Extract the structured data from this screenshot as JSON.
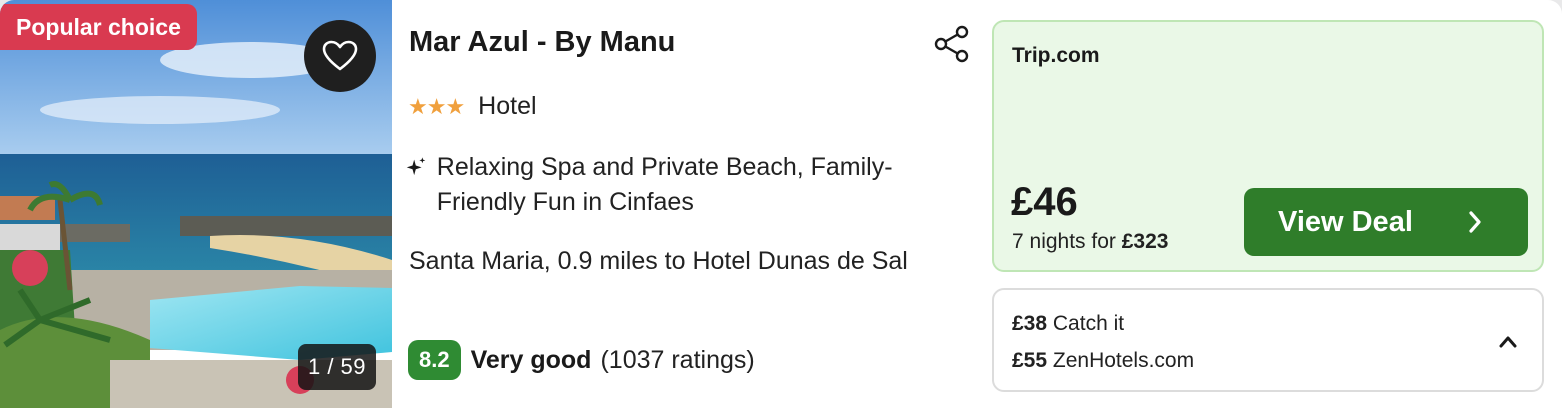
{
  "badge": {
    "label": "Popular choice"
  },
  "gallery": {
    "counter": "1 / 59"
  },
  "hotel": {
    "name": "Mar Azul - By Manu",
    "stars_glyph": "★★★",
    "star_count": 3,
    "type": "Hotel",
    "tagline": "Relaxing Spa and Private Beach, Family-Friendly Fun in Cinfaes",
    "location": "Santa Maria, 0.9 miles to Hotel Dunas de Sal"
  },
  "review": {
    "score": "8.2",
    "label": "Very good",
    "count": "(1037 ratings)"
  },
  "deal": {
    "provider": "Trip.com",
    "price": "£46",
    "nights_prefix": "7 nights for",
    "total": "£323",
    "button_label": "View Deal"
  },
  "other_offers": [
    {
      "price": "£38",
      "provider": "Catch it"
    },
    {
      "price": "£55",
      "provider": "ZenHotels.com"
    }
  ],
  "icons": {
    "favorite": "heart-icon",
    "share": "share-icon",
    "tagline": "sparkle-icon",
    "button": "chevron-right-icon",
    "collapse": "chevron-up-icon"
  },
  "colors": {
    "popular_badge": "#d93a50",
    "stars": "#f0a03d",
    "score_badge": "#2f8b33",
    "view_deal": "#2f7d2a",
    "deal_background": "#eaf8e7",
    "deal_border": "#bfe6b5"
  }
}
